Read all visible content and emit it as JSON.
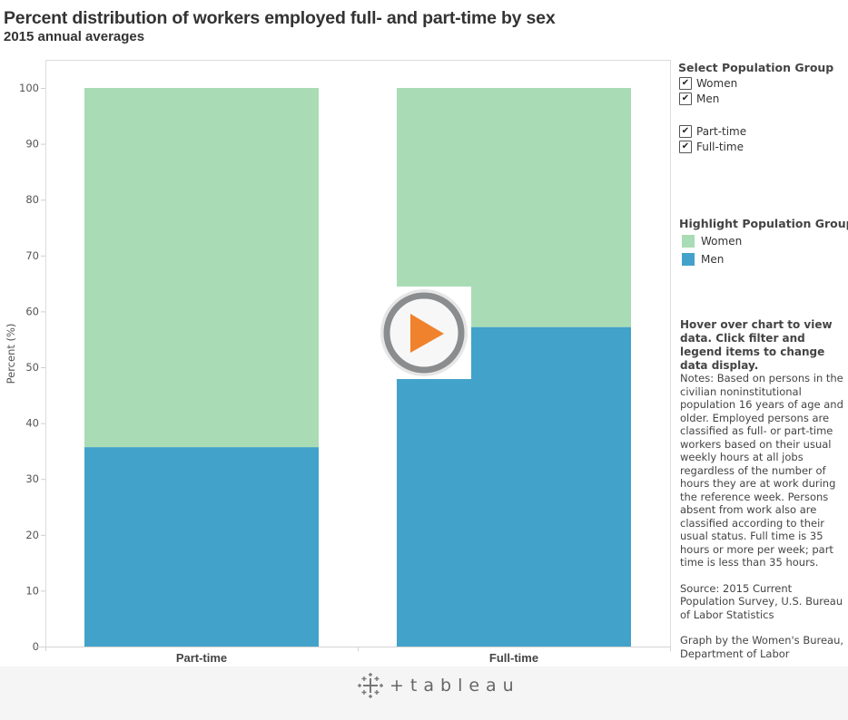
{
  "header": {
    "title": "Percent distribution of workers employed full- and part-time by sex",
    "subtitle": "2015 annual averages"
  },
  "filters": {
    "heading": "Select Population Group",
    "sex_options": [
      {
        "label": "Women",
        "checked": true
      },
      {
        "label": "Men",
        "checked": true
      }
    ],
    "status_options": [
      {
        "label": "Part-time",
        "checked": true
      },
      {
        "label": "Full-time",
        "checked": true
      }
    ],
    "check_glyph": "✔"
  },
  "legend": {
    "heading": "Highlight Population Group",
    "items": [
      {
        "label": "Women",
        "color": "#a9dcb5"
      },
      {
        "label": "Men",
        "color": "#42a2ca"
      }
    ]
  },
  "sidebar_text": {
    "hover_instructions": "Hover over chart to view data. Click filter and legend items to change data display.",
    "notes": "Notes: Based on persons in the civilian noninstitutional population 16 years of age and older. Employed persons are classified as full- or part-time workers based on their usual weekly hours at all jobs regardless of the number of hours they are at work during the reference week. Persons absent from work also are classified according to their usual status. Full time is 35 hours or more per week; part time is less than 35 hours.",
    "source": "Source: 2015 Current Population Survey, U.S. Bureau of Labor Statistics",
    "credit": "Graph by the Women's Bureau, Department of Labor"
  },
  "footer": {
    "brand": "tableau",
    "background": "#f5f5f5"
  },
  "overlay": {
    "icon": "play-icon",
    "accent": "#f0822d",
    "ring": "#8a8c8e"
  },
  "chart_data": {
    "type": "bar",
    "stacked": true,
    "title": "Percent distribution of workers employed full- and part-time by sex",
    "subtitle": "2015 annual averages",
    "xlabel": "",
    "ylabel": "Percent (%)",
    "categories": [
      "Part-time",
      "Full-time"
    ],
    "series": [
      {
        "name": "Men",
        "color": "#42a2ca",
        "values": [
          35.7,
          57.2
        ]
      },
      {
        "name": "Women",
        "color": "#a9dcb5",
        "values": [
          64.3,
          42.8
        ]
      }
    ],
    "ylim": [
      0,
      100
    ],
    "yticks": [
      0,
      10,
      20,
      30,
      40,
      50,
      60,
      70,
      80,
      90,
      100
    ],
    "grid": false,
    "legend_position": "right"
  }
}
